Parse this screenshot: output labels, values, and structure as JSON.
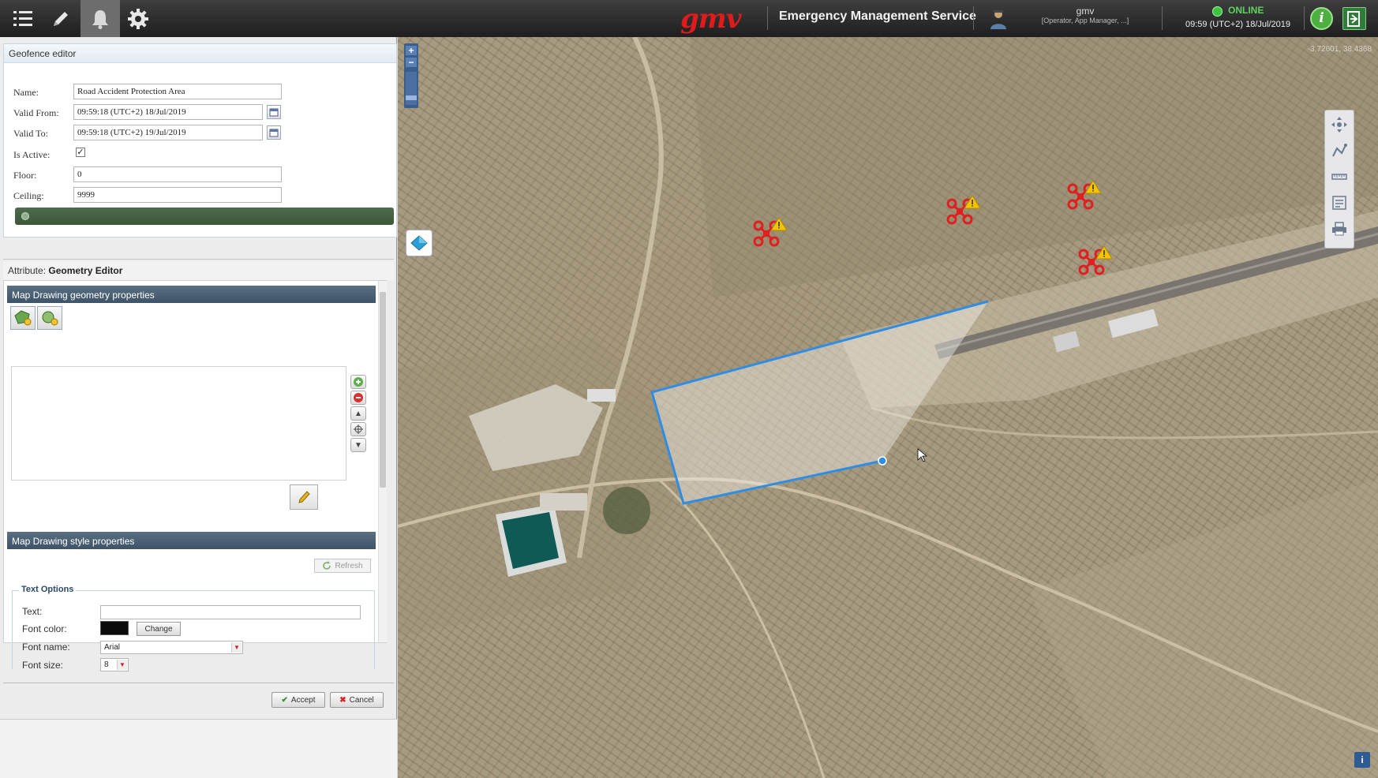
{
  "app": {
    "logo_text": "gmv",
    "service_title": "Emergency Management Service",
    "user": {
      "name": "gmv",
      "role": "[Operator, App Manager, ...]"
    },
    "status": {
      "label": "ONLINE",
      "clock": "09:59 (UTC+2) 18/Jul/2019"
    },
    "info_label": "i",
    "colors": {
      "brand_red": "#e01b1b",
      "online_green": "#3fc23f",
      "geofence_blue": "#2f8de4",
      "drone_red": "#e02020"
    }
  },
  "toolbar_icons": [
    "menu-list-icon",
    "pencil-icon",
    "bell-icon",
    "gear-icon"
  ],
  "geofence_editor": {
    "title": "Geofence editor",
    "fields": {
      "name": {
        "label": "Name:",
        "value": "Road Accident Protection Area"
      },
      "valid_from": {
        "label": "Valid From:",
        "value": "09:59:18 (UTC+2) 18/Jul/2019"
      },
      "valid_to": {
        "label": "Valid To:",
        "value": "09:59:18 (UTC+2) 19/Jul/2019"
      },
      "is_active": {
        "label": "Is Active:",
        "checked": true,
        "mark": "✓"
      },
      "floor": {
        "label": "Floor:",
        "value": "0"
      },
      "ceiling": {
        "label": "Ceiling:",
        "value": "9999"
      }
    }
  },
  "attribute": {
    "prefix": "Attribute:",
    "name": "Geometry Editor"
  },
  "geometry_panel": {
    "drawing_geometry_title": "Map Drawing geometry properties",
    "drawing_style_title": "Map Drawing style properties",
    "refresh_label": "Refresh",
    "text_options": {
      "legend": "Text Options",
      "text_label": "Text:",
      "text_value": "",
      "font_color_label": "Font color:",
      "font_color_value": "#0b0b0b",
      "change_label": "Change",
      "font_name_label": "Font name:",
      "font_name_value": "Arial",
      "font_size_label": "Font size:",
      "font_size_value": "8"
    }
  },
  "actions": {
    "accept": "Accept",
    "cancel": "Cancel"
  },
  "map": {
    "zoom_in": "+",
    "zoom_out": "−",
    "coordinates": "-3.72601, 38.4368",
    "drone_count": 4
  }
}
